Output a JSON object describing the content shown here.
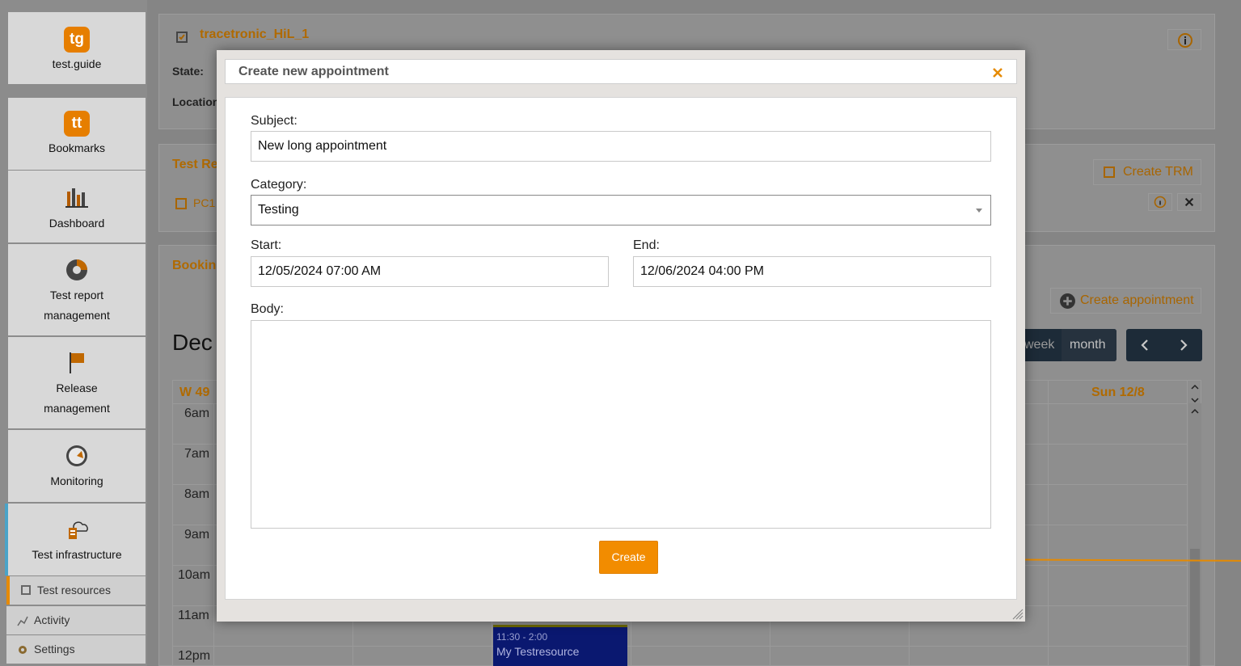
{
  "sidebar": {
    "items": [
      {
        "label": "test.guide",
        "icon": "tg"
      },
      {
        "label": "Bookmarks",
        "icon": "tt"
      },
      {
        "label": "Dashboard",
        "icon": "dashboard-icon"
      },
      {
        "label": "Test report",
        "label2": "management",
        "icon": "pie-chart-icon"
      },
      {
        "label": "Release",
        "label2": "management",
        "icon": "flag-icon"
      },
      {
        "label": "Monitoring",
        "icon": "gauge-icon"
      },
      {
        "label": "Test infrastructure",
        "icon": "infrastructure-icon"
      }
    ],
    "sub_items": [
      {
        "label": "Test resources",
        "icon": "chip-icon"
      },
      {
        "label": "Activity",
        "icon": "chart-icon"
      },
      {
        "label": "Settings",
        "icon": "gear-icon"
      }
    ]
  },
  "resource": {
    "title": "tracetronic_HiL_1",
    "state_label": "State:",
    "location_label": "Location"
  },
  "test_resource_panel": {
    "title": "Test Re",
    "item": "PC1",
    "create_trm_label": "Create TRM"
  },
  "booking_panel": {
    "title": "Bookin",
    "create_appointment_label": "Create appointment",
    "month_heading": "Dec",
    "view_week": "week",
    "view_month": "month",
    "week_label": "W 49",
    "day_header": "Sun 12/8",
    "hours": [
      "6am",
      "7am",
      "8am",
      "9am",
      "10am",
      "11am",
      "12pm"
    ],
    "event": {
      "time": "11:30 - 2:00",
      "title": "My Testresource"
    }
  },
  "modal": {
    "title": "Create new appointment",
    "subject_label": "Subject:",
    "subject_value": "New long appointment",
    "category_label": "Category:",
    "category_value": "Testing",
    "start_label": "Start:",
    "start_value": "12/05/2024 07:00 AM",
    "end_label": "End:",
    "end_value": "12/06/2024 04:00 PM",
    "body_label": "Body:",
    "body_value": "",
    "create_label": "Create"
  },
  "colors": {
    "accent": "#f28c00",
    "highlight": "#4aa3c8"
  }
}
